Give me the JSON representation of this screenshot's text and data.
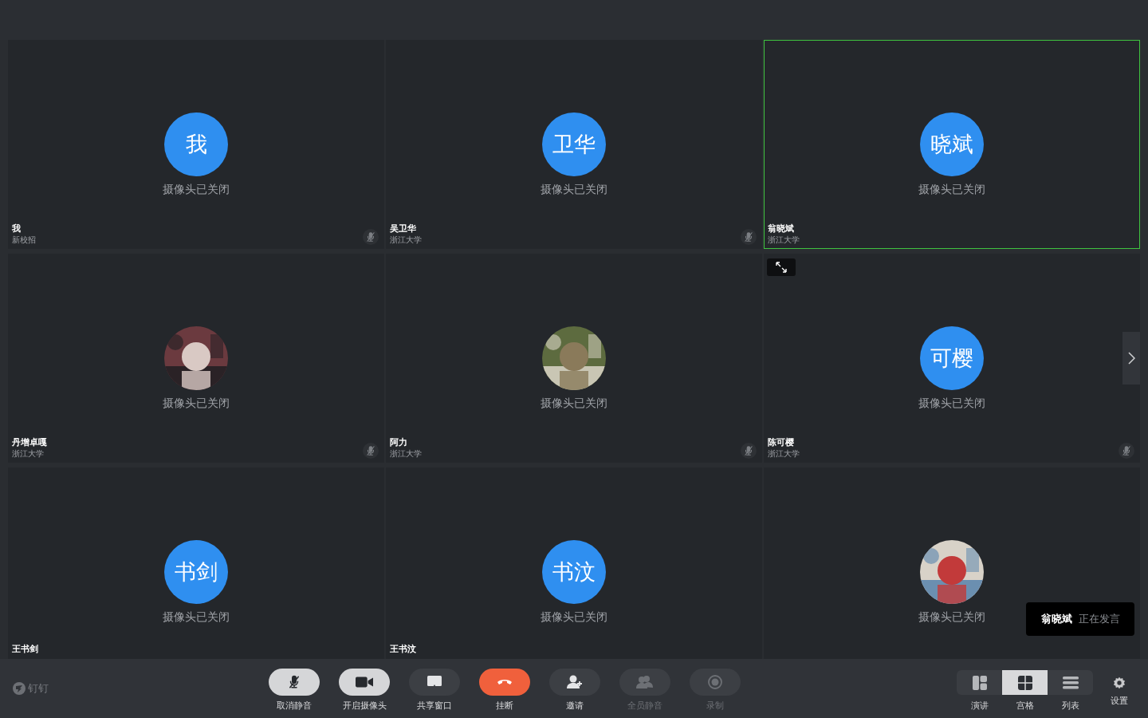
{
  "tiles": [
    {
      "avatar": {
        "kind": "initials",
        "text": "我"
      },
      "caption": "摄像头已关闭",
      "name": "我",
      "org": "新校招",
      "muted": true,
      "speaking": false,
      "hovered": false
    },
    {
      "avatar": {
        "kind": "initials",
        "text": "卫华"
      },
      "caption": "摄像头已关闭",
      "name": "吴卫华",
      "org": "浙江大学",
      "muted": true,
      "speaking": false,
      "hovered": false
    },
    {
      "avatar": {
        "kind": "initials",
        "text": "晓斌"
      },
      "caption": "摄像头已关闭",
      "name": "翁晓斌",
      "org": "浙江大学",
      "muted": false,
      "speaking": true,
      "hovered": false
    },
    {
      "caption": "摄像头已关闭",
      "name": "丹增卓嘎",
      "org": "浙江大学",
      "muted": true,
      "speaking": false,
      "hovered": false
    },
    {
      "caption": "摄像头已关闭",
      "name": "阿力",
      "org": "浙江大学",
      "muted": true,
      "speaking": false,
      "hovered": false
    },
    {
      "avatar": {
        "kind": "initials",
        "text": "可樱"
      },
      "caption": "摄像头已关闭",
      "name": "陈可樱",
      "org": "浙江大学",
      "muted": true,
      "speaking": false,
      "hovered": true
    },
    {
      "avatar": {
        "kind": "initials",
        "text": "书剑"
      },
      "caption": "摄像头已关闭",
      "name": "王书剑",
      "muted": false,
      "speaking": false,
      "hovered": false
    },
    {
      "avatar": {
        "kind": "initials",
        "text": "书汶"
      },
      "caption": "摄像头已关闭",
      "name": "王书汶",
      "muted": false,
      "speaking": false,
      "hovered": false
    },
    {
      "caption": "摄像头已关闭",
      "muted": false,
      "speaking": false,
      "hovered": false
    }
  ],
  "speaking_toast": {
    "name": "翁晓斌",
    "status": "正在发言"
  },
  "brand": "钉钉",
  "controls": [
    {
      "kind": "mic",
      "label": "取消静音",
      "disabled": false
    },
    {
      "kind": "camera",
      "label": "开启摄像头",
      "disabled": false
    },
    {
      "kind": "share",
      "label": "共享窗口",
      "disabled": false
    },
    {
      "kind": "hangup",
      "label": "挂断",
      "disabled": false
    },
    {
      "kind": "invite",
      "label": "邀请",
      "disabled": false
    },
    {
      "kind": "muteall",
      "label": "全员静音",
      "disabled": true
    },
    {
      "kind": "record",
      "label": "录制",
      "disabled": true
    }
  ],
  "views": [
    {
      "kind": "speaker",
      "label": "演讲",
      "selected": false
    },
    {
      "kind": "grid",
      "label": "宫格",
      "selected": true
    },
    {
      "kind": "list",
      "label": "列表",
      "selected": false
    }
  ],
  "settings": {
    "label": "设置"
  }
}
